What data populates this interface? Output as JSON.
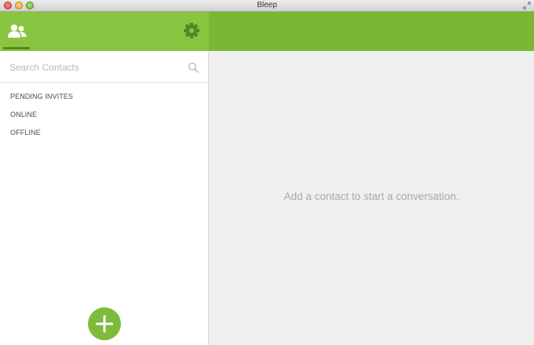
{
  "window": {
    "title": "Bleep"
  },
  "header": {
    "contacts_icon": "contacts-icon",
    "settings_icon": "gear-icon"
  },
  "search": {
    "placeholder": "Search Contacts",
    "value": "",
    "icon": "search-icon"
  },
  "sections": [
    {
      "label": "PENDING INVITES"
    },
    {
      "label": "ONLINE"
    },
    {
      "label": "OFFLINE"
    }
  ],
  "add_button": {
    "icon": "plus-icon"
  },
  "main": {
    "empty_message": "Add a contact to start a conversation."
  },
  "colors": {
    "left_header": "#8ac541",
    "right_header": "#7ab833",
    "accent_dark": "#4e8a22",
    "add_button": "#7dbb3b",
    "main_background": "#efefef"
  }
}
